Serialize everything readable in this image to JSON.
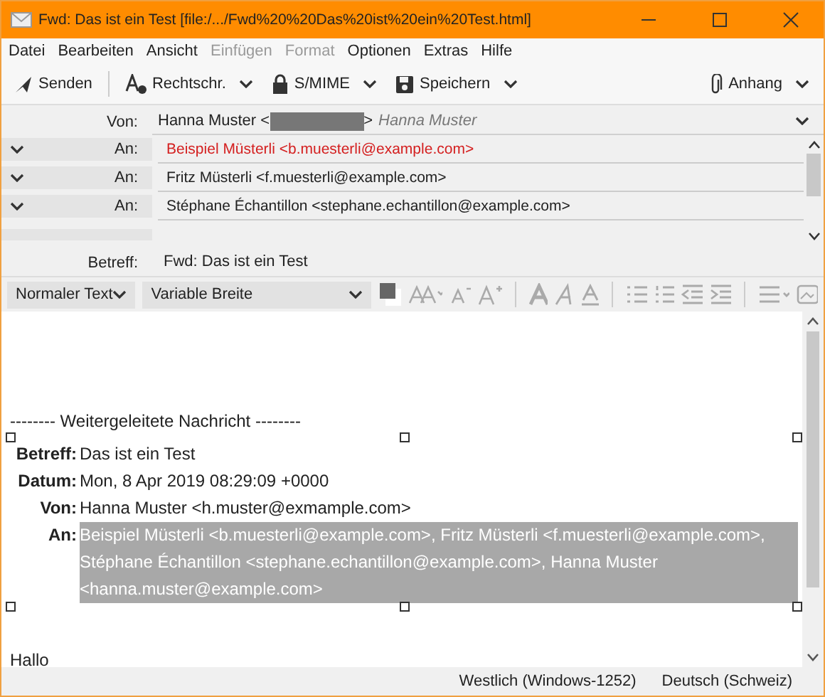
{
  "window": {
    "title": "Fwd: Das ist ein Test [file:/.../Fwd%20%20Das%20ist%20ein%20Test.html]"
  },
  "menu": [
    {
      "label": "Datei",
      "disabled": false
    },
    {
      "label": "Bearbeiten",
      "disabled": false
    },
    {
      "label": "Ansicht",
      "disabled": false
    },
    {
      "label": "Einfügen",
      "disabled": true
    },
    {
      "label": "Format",
      "disabled": true
    },
    {
      "label": "Optionen",
      "disabled": false
    },
    {
      "label": "Extras",
      "disabled": false
    },
    {
      "label": "Hilfe",
      "disabled": false
    }
  ],
  "toolbar": [
    {
      "label": "Senden"
    },
    {
      "label": "Rechtschr."
    },
    {
      "label": "S/MIME"
    },
    {
      "label": "Speichern"
    }
  ],
  "attach": {
    "label": "Anhang"
  },
  "from": {
    "label": "Von:",
    "name": "Hanna Muster <",
    "suffix": ">",
    "identity": "Hanna Muster"
  },
  "recipients": [
    {
      "label": "An:",
      "address": "Beispiel Müsterli <b.muesterli@example.com>",
      "invalid": true
    },
    {
      "label": "An:",
      "address": "Fritz Müsterli <f.muesterli@example.com>",
      "invalid": false
    },
    {
      "label": "An:",
      "address": "Stéphane Échantillon <stephane.echantillon@example.com>",
      "invalid": false
    }
  ],
  "subject": {
    "label": "Betreff:",
    "value": "Fwd: Das ist ein Test"
  },
  "format": {
    "paragraph": "Normaler Text",
    "font": "Variable Breite"
  },
  "body": {
    "separator": "-------- Weitergeleitete Nachricht --------",
    "fields": [
      {
        "label": "Betreff:",
        "value": "Das ist ein Test",
        "selected": false
      },
      {
        "label": "Datum:",
        "value": "Mon, 8 Apr 2019 08:29:09 +0000",
        "selected": false
      },
      {
        "label": "Von:",
        "value": "Hanna Muster <h.muster@exmample.com>",
        "selected": false
      },
      {
        "label": "An:",
        "value": "Beispiel Müsterli <b.muesterli@example.com>, Fritz Müsterli <f.muesterli@example.com>, Stéphane Échantillon <stephane.echantillon@example.com>, Hanna Muster <hanna.muster@example.com>",
        "selected": true
      }
    ],
    "greeting": "Hallo"
  },
  "status": {
    "encoding": "Westlich (Windows-1252)",
    "language": "Deutsch (Schweiz)"
  }
}
